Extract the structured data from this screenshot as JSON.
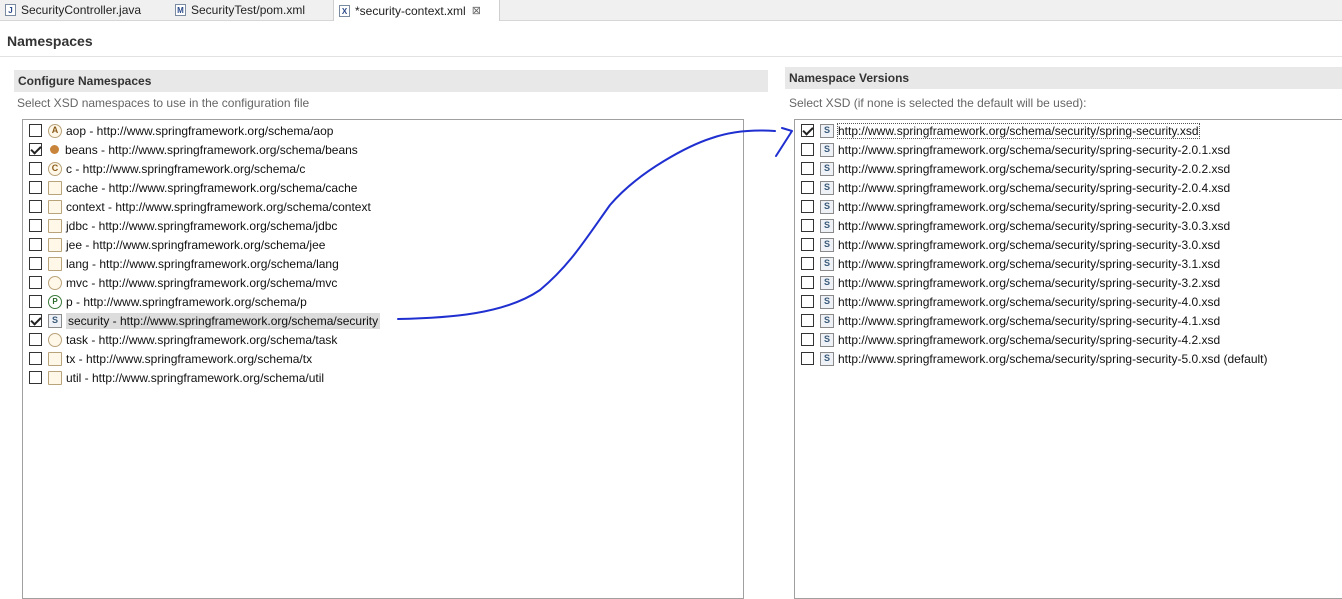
{
  "tabs": [
    {
      "label": "SecurityController.java",
      "icon": "java-file-icon",
      "glyph": "J"
    },
    {
      "label": "SecurityTest/pom.xml",
      "icon": "maven-pom-icon",
      "glyph": "M"
    },
    {
      "label": "*security-context.xml",
      "icon": "xml-file-icon",
      "glyph": "X",
      "active": true,
      "close": "⊠"
    }
  ],
  "page": {
    "title": "Namespaces"
  },
  "configure": {
    "title": "Configure Namespaces",
    "description": "Select XSD namespaces to use in the configuration file",
    "items": [
      {
        "label": "aop - http://www.springframework.org/schema/aop",
        "checked": false,
        "icon": "aop-icon"
      },
      {
        "label": "beans - http://www.springframework.org/schema/beans",
        "checked": true,
        "icon": "bean-icon"
      },
      {
        "label": "c - http://www.springframework.org/schema/c",
        "checked": false,
        "icon": "c-namespace-icon"
      },
      {
        "label": "cache - http://www.springframework.org/schema/cache",
        "checked": false,
        "icon": "cache-icon"
      },
      {
        "label": "context - http://www.springframework.org/schema/context",
        "checked": false,
        "icon": "context-icon"
      },
      {
        "label": "jdbc - http://www.springframework.org/schema/jdbc",
        "checked": false,
        "icon": "jdbc-icon"
      },
      {
        "label": "jee - http://www.springframework.org/schema/jee",
        "checked": false,
        "icon": "jee-icon"
      },
      {
        "label": "lang - http://www.springframework.org/schema/lang",
        "checked": false,
        "icon": "lang-icon"
      },
      {
        "label": "mvc - http://www.springframework.org/schema/mvc",
        "checked": false,
        "icon": "mvc-icon"
      },
      {
        "label": "p - http://www.springframework.org/schema/p",
        "checked": false,
        "icon": "p-namespace-icon"
      },
      {
        "label": "security - http://www.springframework.org/schema/security",
        "checked": true,
        "icon": "security-icon",
        "selected": true
      },
      {
        "label": "task - http://www.springframework.org/schema/task",
        "checked": false,
        "icon": "task-icon"
      },
      {
        "label": "tx - http://www.springframework.org/schema/tx",
        "checked": false,
        "icon": "tx-icon"
      },
      {
        "label": "util - http://www.springframework.org/schema/util",
        "checked": false,
        "icon": "util-icon"
      }
    ]
  },
  "versions": {
    "title": "Namespace Versions",
    "description": "Select XSD (if none is selected the default will be used):",
    "items": [
      {
        "label": "http://www.springframework.org/schema/security/spring-security.xsd",
        "checked": true,
        "focused": true
      },
      {
        "label": "http://www.springframework.org/schema/security/spring-security-2.0.1.xsd",
        "checked": false
      },
      {
        "label": "http://www.springframework.org/schema/security/spring-security-2.0.2.xsd",
        "checked": false
      },
      {
        "label": "http://www.springframework.org/schema/security/spring-security-2.0.4.xsd",
        "checked": false
      },
      {
        "label": "http://www.springframework.org/schema/security/spring-security-2.0.xsd",
        "checked": false
      },
      {
        "label": "http://www.springframework.org/schema/security/spring-security-3.0.3.xsd",
        "checked": false
      },
      {
        "label": "http://www.springframework.org/schema/security/spring-security-3.0.xsd",
        "checked": false
      },
      {
        "label": "http://www.springframework.org/schema/security/spring-security-3.1.xsd",
        "checked": false
      },
      {
        "label": "http://www.springframework.org/schema/security/spring-security-3.2.xsd",
        "checked": false
      },
      {
        "label": "http://www.springframework.org/schema/security/spring-security-4.0.xsd",
        "checked": false
      },
      {
        "label": "http://www.springframework.org/schema/security/spring-security-4.1.xsd",
        "checked": false
      },
      {
        "label": "http://www.springframework.org/schema/security/spring-security-4.2.xsd",
        "checked": false
      },
      {
        "label": "http://www.springframework.org/schema/security/spring-security-5.0.xsd (default)",
        "checked": false
      }
    ]
  },
  "colors": {
    "annotation": "#1f2fd0",
    "header_bg": "#e8e8e8",
    "selection_bg": "#dcdcdc"
  }
}
